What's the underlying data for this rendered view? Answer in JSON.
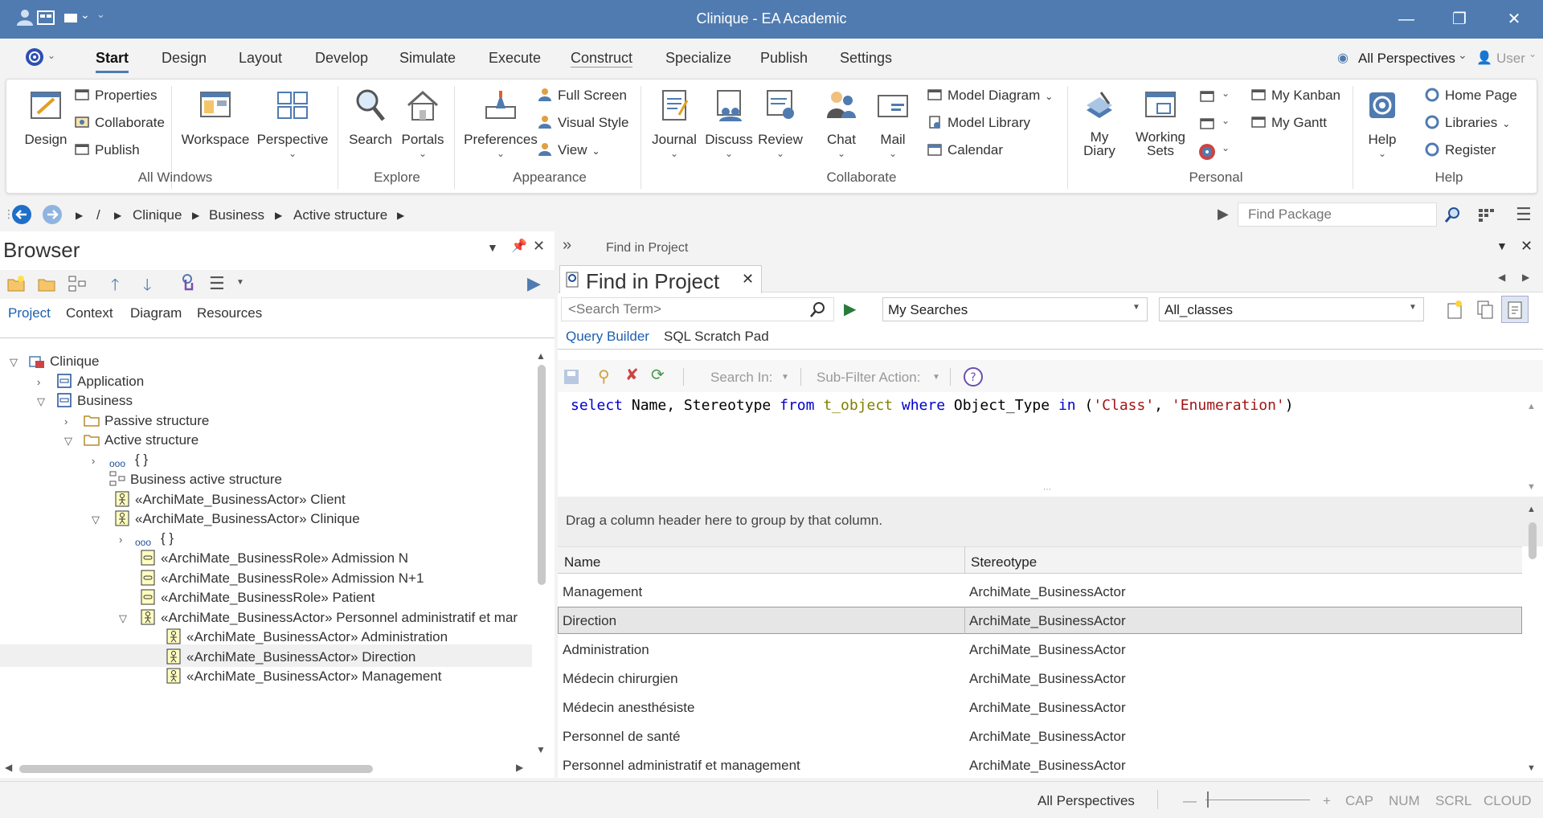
{
  "window": {
    "title": "Clinique - EA Academic",
    "minimize": "—",
    "restore": "❐",
    "close": "✕"
  },
  "menu": {
    "tabs": [
      "Start",
      "Design",
      "Layout",
      "Develop",
      "Simulate",
      "Execute",
      "Construct",
      "Specialize",
      "Publish",
      "Settings"
    ],
    "perspectives": "All Perspectives",
    "user": "User"
  },
  "ribbon": {
    "design": "Design",
    "properties": "Properties",
    "collaborate": "Collaborate",
    "publish": "Publish",
    "workspace": "Workspace",
    "perspective": "Perspective",
    "all_windows": "All Windows",
    "search": "Search",
    "portals": "Portals",
    "explore": "Explore",
    "preferences": "Preferences",
    "full_screen": "Full Screen",
    "visual_style": "Visual Style",
    "view": "View",
    "appearance": "Appearance",
    "journal": "Journal",
    "discuss": "Discuss",
    "review": "Review",
    "chat": "Chat",
    "mail": "Mail",
    "model_diagram": "Model Diagram",
    "model_library": "Model Library",
    "calendar": "Calendar",
    "collaborate_group": "Collaborate",
    "my_diary_1": "My",
    "my_diary_2": "Diary",
    "working_sets_1": "Working",
    "working_sets_2": "Sets",
    "my_kanban": "My Kanban",
    "my_gantt": "My Gantt",
    "personal": "Personal",
    "help": "Help",
    "home_page": "Home Page",
    "libraries": "Libraries",
    "register": "Register",
    "help_group": "Help"
  },
  "breadcrumb": {
    "root": "/",
    "items": [
      "Clinique",
      "Business",
      "Active structure"
    ],
    "find_placeholder": "Find Package"
  },
  "browser": {
    "title": "Browser",
    "tabs": [
      "Project",
      "Context",
      "Diagram",
      "Resources"
    ],
    "tree": [
      "Clinique",
      "Application",
      "Business",
      "Passive structure",
      "Active structure",
      "{ }",
      "Business active structure",
      "«ArchiMate_BusinessActor» Client",
      "«ArchiMate_BusinessActor» Clinique",
      "{ }",
      "«ArchiMate_BusinessRole» Admission N",
      "«ArchiMate_BusinessRole» Admission N+1",
      "«ArchiMate_BusinessRole» Patient",
      "«ArchiMate_BusinessActor» Personnel administratif et mar",
      "«ArchiMate_BusinessActor» Administration",
      "«ArchiMate_BusinessActor» Direction",
      "«ArchiMate_BusinessActor» Management"
    ]
  },
  "find": {
    "header": "Find in Project",
    "tab_title": "Find in Project",
    "search_placeholder": "<Search Term>",
    "my_searches": "My Searches",
    "search_name": "All_classes",
    "subtabs": [
      "Query Builder",
      "SQL Scratch Pad"
    ],
    "search_in": "Search In:",
    "sub_filter": "Sub-Filter Action:",
    "sql": {
      "k1": "select",
      "t1": " Name, Stereotype ",
      "k2": "from",
      "t2": " ",
      "tbl": "t_object",
      "t3": " ",
      "k3": "where",
      "t4": " Object_Type ",
      "k4": "in",
      "t5": " (",
      "s1": "'Class'",
      "t6": ", ",
      "s2": "'Enumeration'",
      "t7": ")"
    },
    "group_hint": "Drag a column header here to group by that column.",
    "columns": [
      "Name",
      "Stereotype"
    ],
    "rows": [
      [
        "Management",
        "ArchiMate_BusinessActor"
      ],
      [
        "Direction",
        "ArchiMate_BusinessActor"
      ],
      [
        "Administration",
        "ArchiMate_BusinessActor"
      ],
      [
        "Médecin chirurgien",
        "ArchiMate_BusinessActor"
      ],
      [
        "Médecin anesthésiste",
        "ArchiMate_BusinessActor"
      ],
      [
        "Personnel de santé",
        "ArchiMate_BusinessActor"
      ],
      [
        "Personnel administratif et management",
        "ArchiMate_BusinessActor"
      ]
    ]
  },
  "status": {
    "perspectives": "All Perspectives",
    "minus": "—",
    "plus": "+",
    "cap": "CAP",
    "num": "NUM",
    "scrl": "SCRL",
    "cloud": "CLOUD"
  },
  "colors": {
    "titlebar": "#4f7bb0",
    "accent": "#4f7bb0",
    "keyword": "#0000cc",
    "table": "#808000",
    "string": "#a31515"
  }
}
